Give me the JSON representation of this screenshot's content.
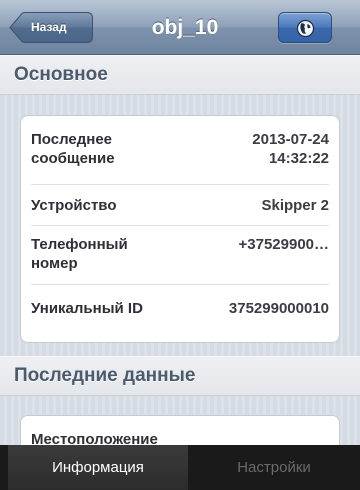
{
  "navbar": {
    "back_label": "Назад",
    "title": "obj_10",
    "right_icon": "globe-icon"
  },
  "sections": {
    "main": {
      "header": "Основное",
      "rows": [
        {
          "label": "Последнее сообщение",
          "value_line1": "2013-07-24",
          "value_line2": "14:32:22"
        },
        {
          "label": "Устройство",
          "value": "Skipper 2"
        },
        {
          "label": "Телефонный номер",
          "value": "+37529900…"
        },
        {
          "label": "Уникальный ID",
          "value": "375299000010"
        }
      ]
    },
    "latest": {
      "header": "Последние данные",
      "rows": [
        {
          "label": "Местоположение"
        }
      ]
    }
  },
  "tabbar": {
    "tabs": [
      {
        "label": "Информация",
        "active": true
      },
      {
        "label": "Настройки",
        "active": false
      }
    ]
  }
}
